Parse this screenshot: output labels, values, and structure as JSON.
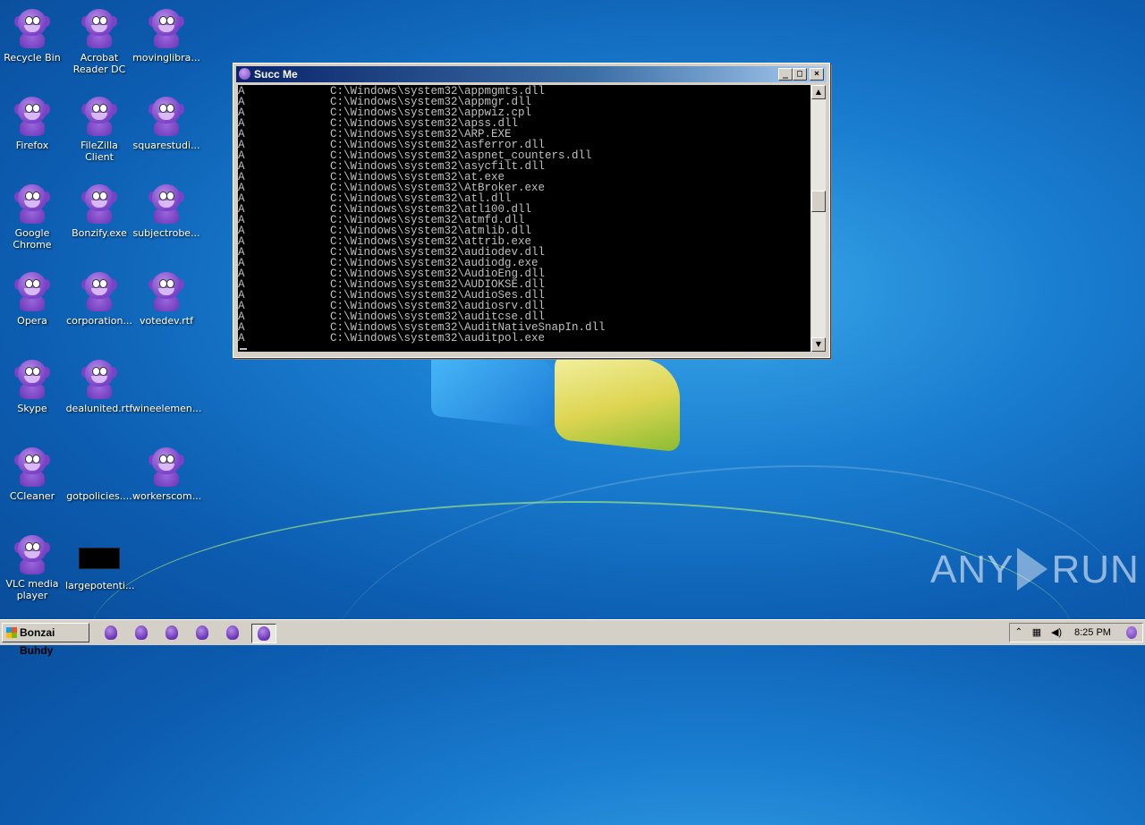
{
  "desktop": {
    "icons": [
      {
        "label": "Recycle Bin",
        "type": "bonzi"
      },
      {
        "label": "Acrobat Reader DC",
        "type": "bonzi"
      },
      {
        "label": "movinglibra...",
        "type": "bonzi"
      },
      {
        "label": "Firefox",
        "type": "bonzi"
      },
      {
        "label": "FileZilla Client",
        "type": "bonzi"
      },
      {
        "label": "squarestudi...",
        "type": "bonzi"
      },
      {
        "label": "Google Chrome",
        "type": "bonzi"
      },
      {
        "label": "Bonzify.exe",
        "type": "bonzi"
      },
      {
        "label": "subjectrobe...",
        "type": "bonzi"
      },
      {
        "label": "Opera",
        "type": "bonzi"
      },
      {
        "label": "corporation...",
        "type": "bonzi"
      },
      {
        "label": "votedev.rtf",
        "type": "bonzi"
      },
      {
        "label": "Skype",
        "type": "bonzi"
      },
      {
        "label": "dealunited.rtf",
        "type": "bonzi"
      },
      {
        "label": "wineelemen...",
        "type": "blank"
      },
      {
        "label": "CCleaner",
        "type": "bonzi"
      },
      {
        "label": "gotpolicies....",
        "type": "blank"
      },
      {
        "label": "workerscom...",
        "type": "bonzi"
      },
      {
        "label": "VLC media player",
        "type": "bonzi"
      },
      {
        "label": "largepotenti...",
        "type": "black"
      }
    ]
  },
  "console": {
    "title": "Succ Me",
    "min_glyph": "_",
    "max_glyph": "□",
    "close_glyph": "×",
    "lines": [
      {
        "attr": "A",
        "path": "C:\\Windows\\system32\\appmgmts.dll"
      },
      {
        "attr": "A",
        "path": "C:\\Windows\\system32\\appmgr.dll"
      },
      {
        "attr": "A",
        "path": "C:\\Windows\\system32\\appwiz.cpl"
      },
      {
        "attr": "A",
        "path": "C:\\Windows\\system32\\apss.dll"
      },
      {
        "attr": "A",
        "path": "C:\\Windows\\system32\\ARP.EXE"
      },
      {
        "attr": "A",
        "path": "C:\\Windows\\system32\\asferror.dll"
      },
      {
        "attr": "A",
        "path": "C:\\Windows\\system32\\aspnet_counters.dll"
      },
      {
        "attr": "A",
        "path": "C:\\Windows\\system32\\asycfilt.dll"
      },
      {
        "attr": "A",
        "path": "C:\\Windows\\system32\\at.exe"
      },
      {
        "attr": "A",
        "path": "C:\\Windows\\system32\\AtBroker.exe"
      },
      {
        "attr": "A",
        "path": "C:\\Windows\\system32\\atl.dll"
      },
      {
        "attr": "A",
        "path": "C:\\Windows\\system32\\atl100.dll"
      },
      {
        "attr": "A",
        "path": "C:\\Windows\\system32\\atmfd.dll"
      },
      {
        "attr": "A",
        "path": "C:\\Windows\\system32\\atmlib.dll"
      },
      {
        "attr": "A",
        "path": "C:\\Windows\\system32\\attrib.exe"
      },
      {
        "attr": "A",
        "path": "C:\\Windows\\system32\\audiodev.dll"
      },
      {
        "attr": "A",
        "path": "C:\\Windows\\system32\\audiodg.exe"
      },
      {
        "attr": "A",
        "path": "C:\\Windows\\system32\\AudioEng.dll"
      },
      {
        "attr": "A",
        "path": "C:\\Windows\\system32\\AUDIOKSE.dll"
      },
      {
        "attr": "A",
        "path": "C:\\Windows\\system32\\AudioSes.dll"
      },
      {
        "attr": "A",
        "path": "C:\\Windows\\system32\\audiosrv.dll"
      },
      {
        "attr": "A",
        "path": "C:\\Windows\\system32\\auditcse.dll"
      },
      {
        "attr": "A",
        "path": "C:\\Windows\\system32\\AuditNativeSnapIn.dll"
      },
      {
        "attr": "A",
        "path": "C:\\Windows\\system32\\auditpol.exe"
      }
    ]
  },
  "taskbar": {
    "start_label": "Bonzai Buhdy",
    "quicklaunch_count": 6,
    "clock": "8:25 PM",
    "tray_icons": [
      "chevron-up-icon",
      "network-icon",
      "volume-icon"
    ]
  },
  "watermark": {
    "left": "ANY",
    "right": "RUN"
  },
  "colors": {
    "console_bg": "#000000",
    "console_text": "#c0c0c0",
    "title_bar": "#0a246a",
    "taskbar": "#d4d0c8"
  }
}
